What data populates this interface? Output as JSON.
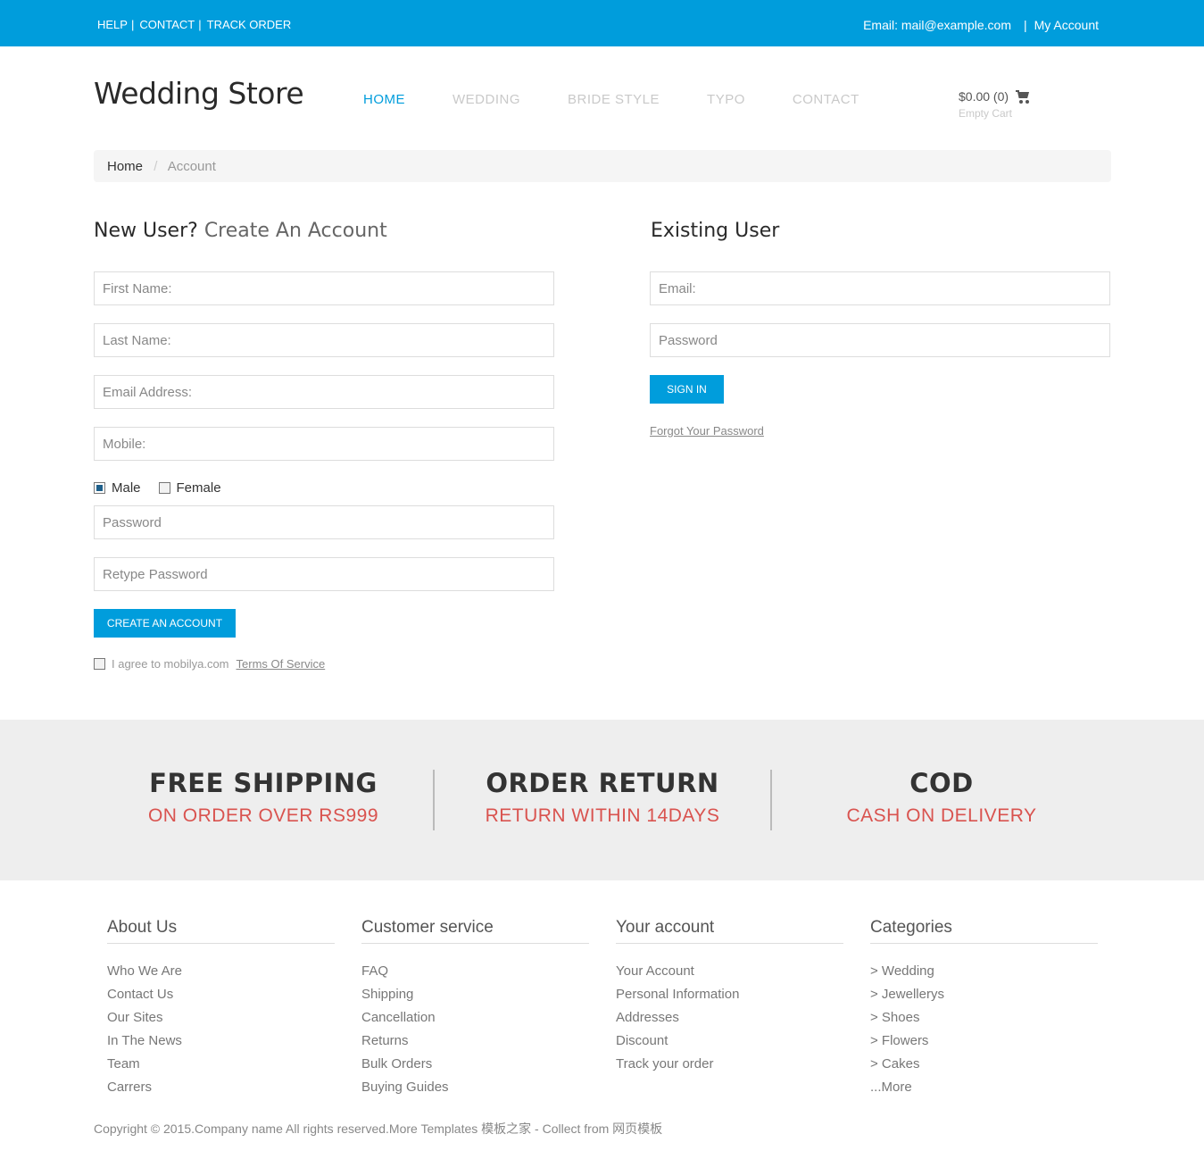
{
  "topbar": {
    "left_links": [
      "HELP",
      "CONTACT",
      "TRACK ORDER"
    ],
    "email": "Email: mail@example.com",
    "my_account": "My Account"
  },
  "header": {
    "logo": "Wedding Store",
    "nav": [
      "HOME",
      "WEDDING",
      "BRIDE STYLE",
      "TYPO",
      "CONTACT"
    ],
    "cart_amount": "$0.00 (0)",
    "cart_status": "Empty Cart"
  },
  "breadcrumb": {
    "home": "Home",
    "separator": "/",
    "current": "Account"
  },
  "register": {
    "title_strong": "New User?",
    "title_muted": "Create An Account",
    "placeholders": {
      "first_name": "First Name:",
      "last_name": "Last Name:",
      "email": "Email Address:",
      "mobile": "Mobile:",
      "password": "Password",
      "retype": "Retype Password"
    },
    "gender_male": "Male",
    "gender_female": "Female",
    "gender_selected": "Male",
    "submit": "CREATE AN ACCOUNT",
    "agree_text": "I agree to mobilya.com",
    "terms": "Terms Of Service"
  },
  "login": {
    "title": "Existing User",
    "placeholders": {
      "email": "Email:",
      "password": "Password"
    },
    "submit": "SIGN IN",
    "forgot": "Forgot Your Password"
  },
  "features": [
    {
      "title": "FREE SHIPPING",
      "subtitle": "ON ORDER OVER RS999"
    },
    {
      "title": "ORDER RETURN",
      "subtitle": "RETURN WITHIN 14DAYS"
    },
    {
      "title": "COD",
      "subtitle": "CASH ON DELIVERY"
    }
  ],
  "footer": {
    "about": {
      "heading": "About Us",
      "links": [
        "Who We Are",
        "Contact Us",
        "Our Sites",
        "In The News",
        "Team",
        "Carrers"
      ]
    },
    "service": {
      "heading": "Customer service",
      "links": [
        "FAQ",
        "Shipping",
        "Cancellation",
        "Returns",
        "Bulk Orders",
        "Buying Guides"
      ]
    },
    "account": {
      "heading": "Your account",
      "links": [
        "Your Account",
        "Personal Information",
        "Addresses",
        "Discount",
        "Track your order"
      ]
    },
    "categories": {
      "heading": "Categories",
      "links": [
        "> Wedding",
        "> Jewellerys",
        "> Shoes",
        "> Flowers",
        "> Cakes",
        "...More"
      ]
    },
    "copyright": "Copyright © 2015.Company name All rights reserved.More Templates 模板之家 - Collect from 网页模板"
  },
  "colors": {
    "accent": "#009ddc",
    "feature_red": "#d9534f"
  },
  "icons": {
    "cart": "shopping-cart-icon"
  }
}
